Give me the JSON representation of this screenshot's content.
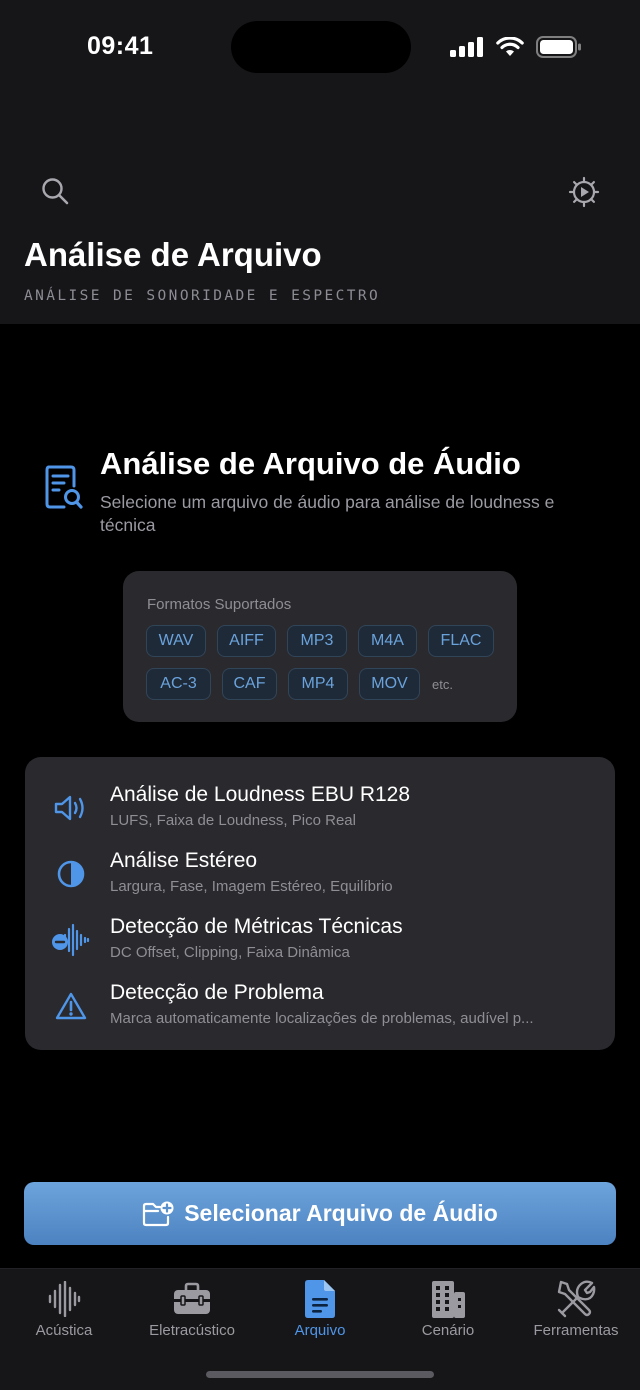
{
  "status_bar": {
    "time": "09:41",
    "icons": [
      "cellular-signal-icon",
      "wifi-icon",
      "battery-icon"
    ]
  },
  "header": {
    "title": "Análise de Arquivo",
    "subtitle": "ANÁLISE DE SONORIDADE E ESPECTRO",
    "left_icon": "search-icon",
    "right_icon": "gear-icon"
  },
  "intro": {
    "icon": "document-search-icon",
    "title": "Análise de Arquivo de Áudio",
    "description": "Selecione um arquivo de áudio para análise de loudness e técnica"
  },
  "formats": {
    "label": "Formatos Suportados",
    "row1": [
      "WAV",
      "AIFF",
      "MP3",
      "M4A",
      "FLAC"
    ],
    "row2": [
      "AC-3",
      "CAF",
      "MP4",
      "MOV"
    ],
    "etc": "etc."
  },
  "features": [
    {
      "icon": "speaker-wave-icon",
      "title": "Análise de Loudness EBU R128",
      "description": "LUFS, Faixa de Loudness, Pico Real"
    },
    {
      "icon": "half-circle-icon",
      "title": "Análise Estéreo",
      "description": "Largura, Fase, Imagem Estéreo, Equilíbrio"
    },
    {
      "icon": "waveform-minus-icon",
      "title": "Detecção de Métricas Técnicas",
      "description": "DC Offset, Clipping, Faixa Dinâmica"
    },
    {
      "icon": "warning-triangle-icon",
      "title": "Detecção de Problema",
      "description": "Marca automaticamente localizações de problemas, audível p..."
    }
  ],
  "primary_button": {
    "icon": "folder-add-icon",
    "label": "Selecionar Arquivo de Áudio"
  },
  "tabs": [
    {
      "icon": "waveform-icon",
      "label": "Acústica",
      "active": false
    },
    {
      "icon": "toolbox-icon",
      "label": "Eletracústico",
      "active": false
    },
    {
      "icon": "document-icon",
      "label": "Arquivo",
      "active": true
    },
    {
      "icon": "building-icon",
      "label": "Cenário",
      "active": false
    },
    {
      "icon": "tools-icon",
      "label": "Ferramentas",
      "active": false
    }
  ],
  "colors": {
    "accent": "#4f95e8",
    "button_top": "#6ea4dc",
    "button_bottom": "#4c82c0",
    "card": "#29292e",
    "header_bg": "#161618",
    "chip_text": "#6aa3dc"
  }
}
